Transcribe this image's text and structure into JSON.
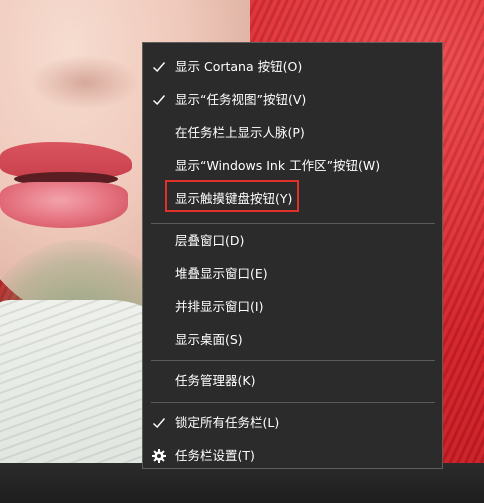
{
  "context_menu": {
    "items": [
      {
        "label": "显示 Cortana 按钮(O)",
        "checked": true
      },
      {
        "label": "显示“任务视图”按钮(V)",
        "checked": true
      },
      {
        "label": "在任务栏上显示人脉(P)",
        "checked": false
      },
      {
        "label": "显示“Windows Ink 工作区”按钮(W)",
        "checked": false
      },
      {
        "label": "显示触摸键盘按钮(Y)",
        "checked": false
      },
      {
        "label": "层叠窗口(D)",
        "checked": false
      },
      {
        "label": "堆叠显示窗口(E)",
        "checked": false
      },
      {
        "label": "并排显示窗口(I)",
        "checked": false
      },
      {
        "label": "显示桌面(S)",
        "checked": false
      },
      {
        "label": "任务管理器(K)",
        "checked": false
      },
      {
        "label": "锁定所有任务栏(L)",
        "checked": true
      },
      {
        "label": "任务栏设置(T)",
        "icon": "gear-icon"
      }
    ]
  },
  "colors": {
    "menu_background": "#2b2b2b",
    "menu_border": "#5d5d5d",
    "menu_text": "#ffffff",
    "highlight_box": "#e0302a"
  }
}
